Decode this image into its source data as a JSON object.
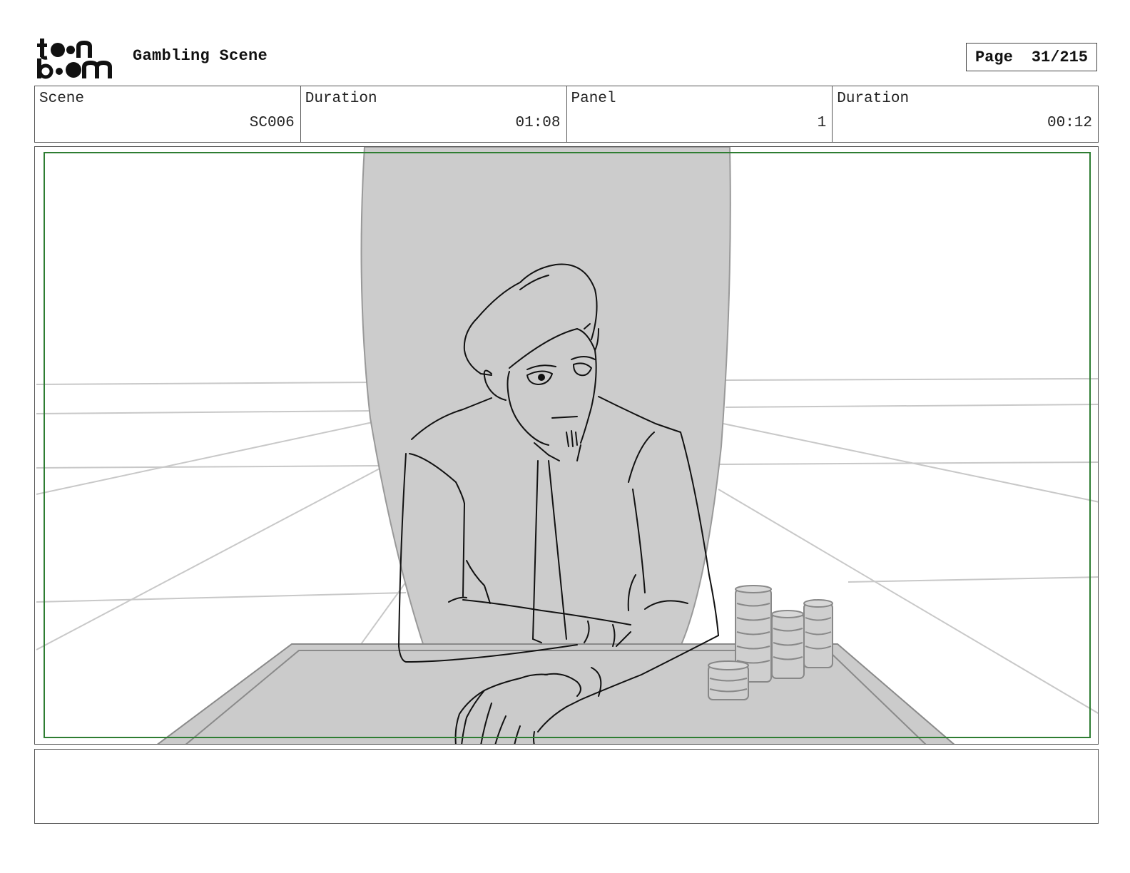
{
  "header": {
    "logo_text": "toon boom",
    "title": "Gambling Scene",
    "page_label": "Page",
    "page_value": "31/215"
  },
  "info": {
    "scene_label": "Scene",
    "scene_value": "SC006",
    "scene_duration_label": "Duration",
    "scene_duration_value": "01:08",
    "panel_label": "Panel",
    "panel_value": "1",
    "panel_duration_label": "Duration",
    "panel_duration_value": "00:12"
  },
  "notes": {
    "text": ""
  },
  "colors": {
    "safe_frame": "#2e7d32",
    "backdrop": "#cccccc",
    "border": "#555555"
  }
}
